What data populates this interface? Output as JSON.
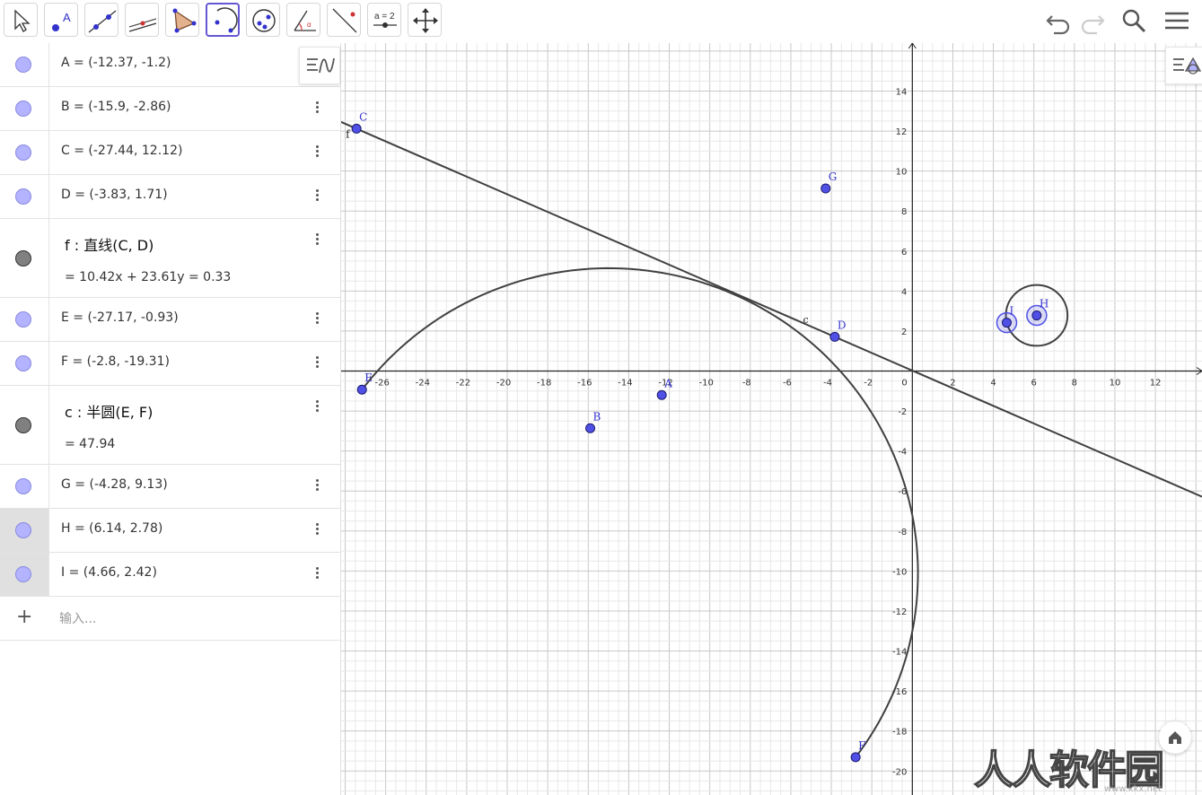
{
  "toolbar": {
    "tools": [
      "move-tool-icon",
      "point-tool-icon",
      "line-tool-icon",
      "perpendicular-tool-icon",
      "polygon-tool-icon",
      "semicircle-tool-icon",
      "conic-tool-icon",
      "angle-tool-icon",
      "reflect-tool-icon",
      "slider-tool-icon",
      "move-view-tool-icon"
    ],
    "active": "semicircle-tool-icon",
    "slider_label": "a = 2"
  },
  "algebra": {
    "rows": [
      {
        "name": "A",
        "kind": "point",
        "text": "A = (-12.37, -1.2)"
      },
      {
        "name": "B",
        "kind": "point",
        "text": "B = (-15.9, -2.86)"
      },
      {
        "name": "C",
        "kind": "point",
        "text": "C = (-27.44, 12.12)"
      },
      {
        "name": "D",
        "kind": "point",
        "text": "D = (-3.83, 1.71)"
      },
      {
        "name": "f",
        "kind": "object",
        "command": "f : 直线(C, D)",
        "value": "=  10.42x + 23.61y = 0.33"
      },
      {
        "name": "E",
        "kind": "point",
        "text": "E = (-27.17, -0.93)"
      },
      {
        "name": "F",
        "kind": "point",
        "text": "F = (-2.8, -19.31)"
      },
      {
        "name": "c",
        "kind": "object",
        "command": "c : 半圆(E, F)",
        "value": "=  47.94"
      },
      {
        "name": "G",
        "kind": "point",
        "text": "G = (-4.28, 9.13)"
      },
      {
        "name": "H",
        "kind": "point",
        "text": "H = (6.14, 2.78)",
        "selected": true
      },
      {
        "name": "I",
        "kind": "point",
        "text": "I = (4.66, 2.42)",
        "selected": true
      }
    ],
    "input_placeholder": "输入..."
  },
  "graphics": {
    "x_ticks": [
      "-26",
      "-24",
      "-22",
      "-20",
      "-18",
      "-16",
      "-14",
      "-12",
      "-10",
      "-8",
      "-6",
      "-4",
      "-2",
      "0",
      "2",
      "4",
      "6",
      "8",
      "10",
      "12"
    ],
    "y_ticks": [
      "14",
      "12",
      "10",
      "8",
      "6",
      "4",
      "2",
      "-2",
      "-4",
      "-6",
      "-8",
      "-10",
      "-12",
      "-14",
      "-16",
      "-18",
      "-20"
    ],
    "xlim": [
      -28.2,
      14.3
    ],
    "ylim": [
      -21.2,
      16.4
    ],
    "grid": true,
    "points": [
      {
        "name": "A",
        "label": "A",
        "x": -12.37,
        "y": -1.2
      },
      {
        "name": "B",
        "label": "B",
        "x": -15.9,
        "y": -2.86
      },
      {
        "name": "C",
        "label": "C",
        "x": -27.44,
        "y": 12.12
      },
      {
        "name": "D",
        "label": "D",
        "x": -3.83,
        "y": 1.71
      },
      {
        "name": "E",
        "label": "E",
        "x": -27.17,
        "y": -0.93
      },
      {
        "name": "F",
        "label": "F",
        "x": -2.8,
        "y": -19.31
      },
      {
        "name": "G",
        "label": "G",
        "x": -4.28,
        "y": 9.13
      },
      {
        "name": "H",
        "label": "H",
        "x": 6.14,
        "y": 2.78,
        "selected": true
      },
      {
        "name": "I",
        "label": "I",
        "x": 4.66,
        "y": 2.42,
        "selected": true
      }
    ],
    "line_label": "f",
    "semicircle_label": "c",
    "circle": {
      "cx": 6.14,
      "cy": 2.78,
      "r": 1.52
    },
    "colors": {
      "point_fill": "#5050e6",
      "point_stroke": "#1a1a6e",
      "curve": "#404040",
      "grid_minor": "#e8e8e8",
      "grid_major": "#c8c8c8",
      "label": "#3333cc"
    }
  },
  "watermark": {
    "text": "人人软件园",
    "url": "www.kkx.net"
  }
}
